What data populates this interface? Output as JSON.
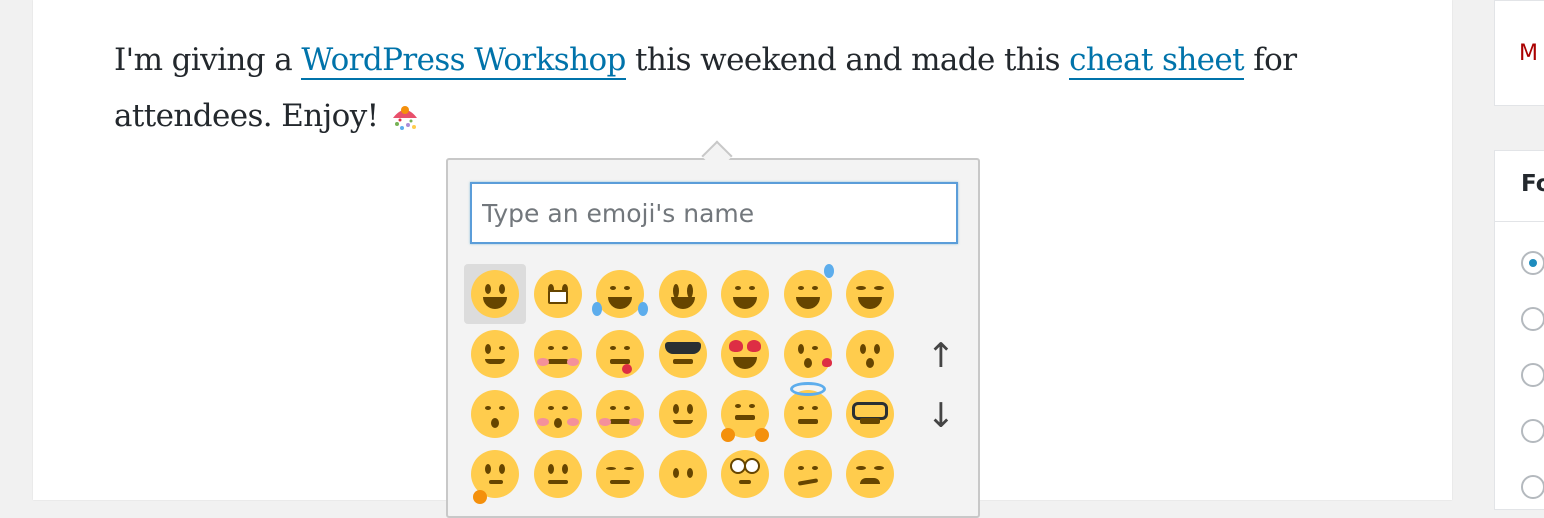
{
  "post": {
    "text_1": "I'm giving a ",
    "link_1": "WordPress Workshop",
    "text_2": " this weekend and made this ",
    "link_2": "cheat sheet",
    "text_3": " for attendees. Enjoy! "
  },
  "emoji_picker": {
    "search_placeholder": "Type an emoji's name",
    "search_value": "",
    "emojis": [
      "grinning",
      "grimacing",
      "joy",
      "smiley",
      "smile",
      "sweat_smile",
      "laughing",
      "wink",
      "blush",
      "yum",
      "sunglasses",
      "heart_eyes",
      "kissing_heart",
      "kissing",
      "kissing_smiling_eyes",
      "kissing_closed_eyes",
      "relaxed",
      "slightly_smiling_face",
      "hugging",
      "innocent",
      "nerd",
      "thinking",
      "neutral_face",
      "expressionless",
      "no_mouth",
      "rolling_eyes",
      "smirk",
      "persevere"
    ],
    "selected_emoji": "grinning",
    "scroll_up_icon": "arrow-up-icon",
    "scroll_down_icon": "arrow-down-icon"
  },
  "sidebar": {
    "box1_text": "M",
    "box2_heading": "Fo",
    "radio_checked_index": 0
  },
  "colors": {
    "link": "#0073aa",
    "focus_border": "#5b9dd9",
    "error_text": "#aa0000"
  }
}
